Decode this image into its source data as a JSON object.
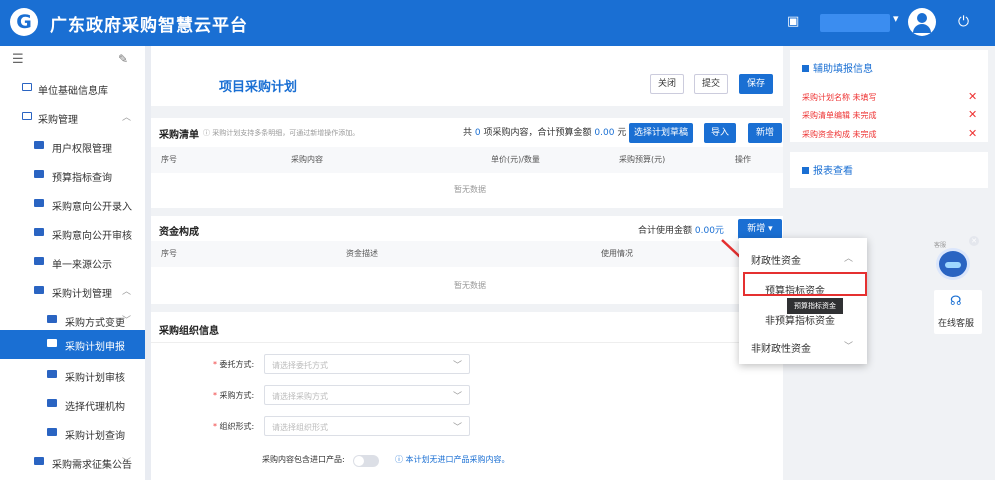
{
  "app": {
    "title": "广东政府采购智慧云平台"
  },
  "sidebar": {
    "items": [
      {
        "label": "单位基础信息库"
      },
      {
        "label": "采购管理"
      },
      {
        "label": "用户权限管理"
      },
      {
        "label": "预算指标查询"
      },
      {
        "label": "采购意向公开录入"
      },
      {
        "label": "采购意向公开审核"
      },
      {
        "label": "单一来源公示"
      },
      {
        "label": "采购计划管理"
      },
      {
        "label": "采购方式变更"
      },
      {
        "label": "采购计划申报"
      },
      {
        "label": "采购计划审核"
      },
      {
        "label": "选择代理机构"
      },
      {
        "label": "采购计划查询"
      },
      {
        "label": "采购需求征集公告"
      }
    ]
  },
  "form": {
    "title": "项目采购计划",
    "close": "关闭",
    "submit": "提交",
    "save": "保存"
  },
  "purchase_list": {
    "title": "采购清单",
    "hint": "ⓘ 采购计划支持多条明细，可通过新增操作添加。",
    "summary_prefix": "共",
    "count": "0",
    "summary_mid": "项采购内容，合计预算金额",
    "amount": "0.00",
    "unit": "元",
    "btn_template": "选择计划草稿",
    "btn_import": "导入",
    "btn_add": "新增",
    "columns": [
      "序号",
      "采购内容",
      "单价(元)/数量",
      "采购预算(元)",
      "操作"
    ],
    "empty": "暂无数据"
  },
  "funding": {
    "title": "资金构成",
    "total_label": "合计使用金额",
    "total": "0.00元",
    "btn_add": "新增",
    "columns": [
      "序号",
      "资金描述",
      "使用情况"
    ],
    "empty": "暂无数据"
  },
  "org": {
    "title": "采购组织信息",
    "fields": [
      {
        "label": "委托方式:",
        "placeholder": "请选择委托方式"
      },
      {
        "label": "采购方式:",
        "placeholder": "请选择采购方式"
      },
      {
        "label": "组织形式:",
        "placeholder": "请选择组织形式"
      }
    ],
    "import_label": "采购内容包含进口产品:",
    "import_hint": "ⓘ 本计划无进口产品采购内容。"
  },
  "dropdown": {
    "items": [
      "财政性资金",
      "预算指标资金",
      "非预算指标资金",
      "非财政性资金"
    ],
    "tooltip": "预算指标资金"
  },
  "assist": {
    "title": "辅助填报信息",
    "items": [
      {
        "name": "采购计划名称",
        "status": "未填写"
      },
      {
        "name": "采购清单编辑",
        "status": "未完成"
      },
      {
        "name": "采购资金构成",
        "status": "未完成"
      }
    ],
    "report_title": "报表查看"
  },
  "service": {
    "badge": "客服",
    "label": "在线客服"
  },
  "colors": {
    "brand": "#1a6fd3",
    "error": "#e33",
    "highlight": "#e53030"
  }
}
